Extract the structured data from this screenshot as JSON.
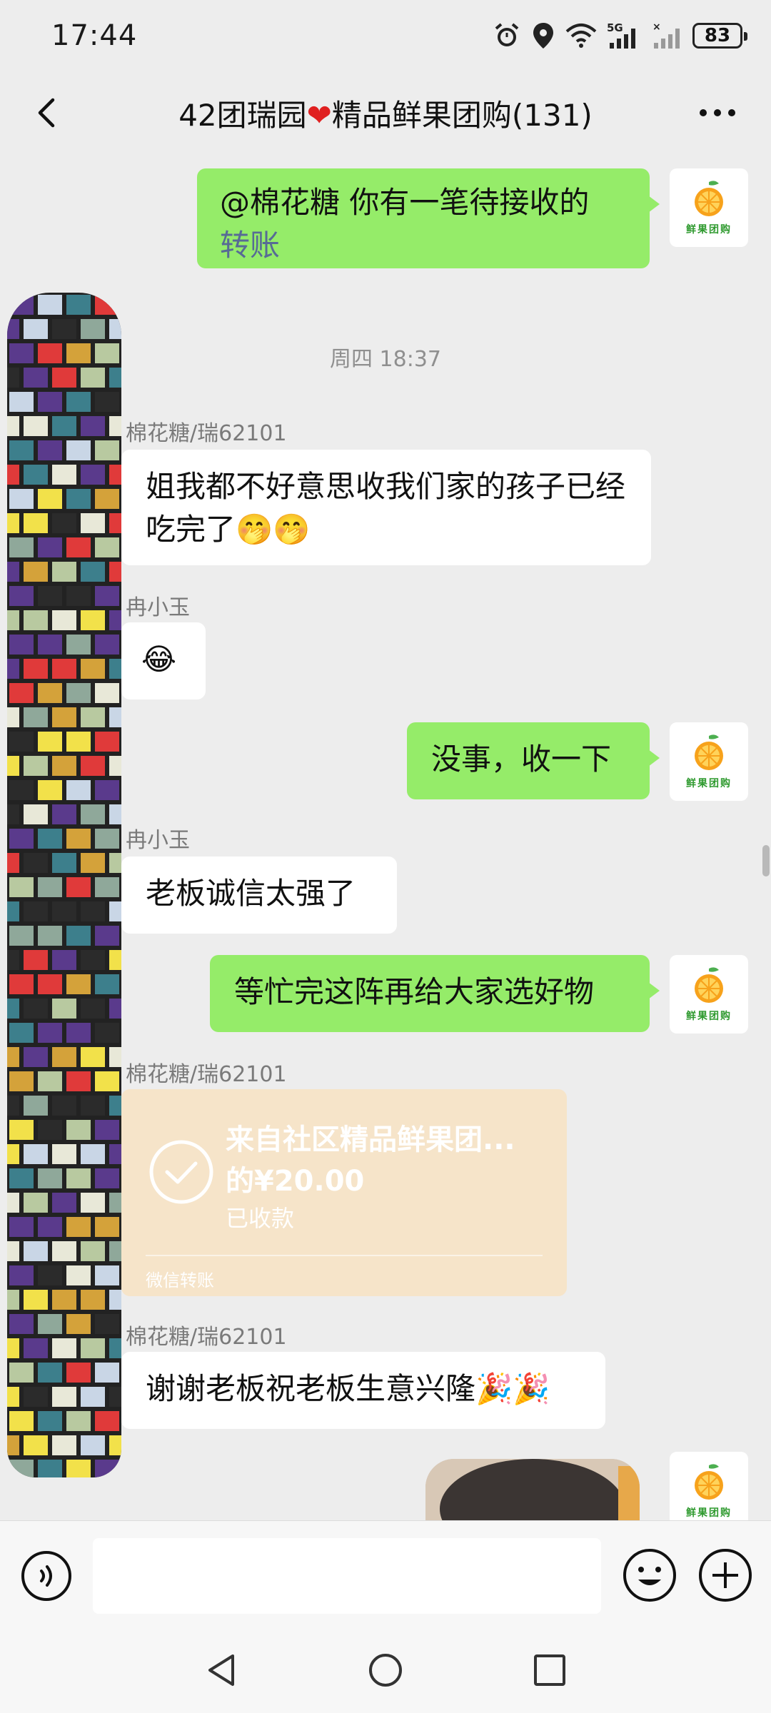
{
  "status_bar": {
    "time": "17:44",
    "network": "5G",
    "battery": "83",
    "icons": [
      "alarm-icon",
      "location-icon",
      "wifi-icon",
      "signal-5g-icon",
      "signal-icon",
      "battery-icon"
    ]
  },
  "header": {
    "title_prefix": "42团瑞园",
    "title_heart": "❤",
    "title_suffix": "精品鲜果团购(131)"
  },
  "avatar": {
    "brand_text": "鲜果团购"
  },
  "messages": [
    {
      "kind": "outgoing",
      "text_line1": "@棉花糖 你有一笔待接收的",
      "link": "转账"
    },
    {
      "kind": "time",
      "text": "周四 18:37"
    },
    {
      "kind": "incoming",
      "sender": "棉花糖/瑞62101",
      "text": "姐我都不好意思收我们家的孩子已经吃完了🤭🤭"
    },
    {
      "kind": "incoming",
      "sender": "冉小玉",
      "text": "😂"
    },
    {
      "kind": "outgoing",
      "text": "没事，收一下"
    },
    {
      "kind": "incoming",
      "sender": "冉小玉",
      "text": "老板诚信太强了"
    },
    {
      "kind": "outgoing",
      "text": "等忙完这阵再给大家选好物"
    },
    {
      "kind": "transfer",
      "sender": "棉花糖/瑞62101",
      "from": "来自社区精品鲜果团...",
      "amount": "的¥20.00",
      "status": "已收款",
      "footer": "微信转账",
      "bg_color": "#f6e4c9"
    },
    {
      "kind": "incoming",
      "sender": "棉花糖/瑞62101",
      "text": "谢谢老板祝老板生意兴隆🎉🎉"
    }
  ],
  "colors": {
    "outgoing_bubble": "#95ec69",
    "incoming_bubble": "#ffffff",
    "link": "#576b95",
    "background": "#ededed"
  }
}
